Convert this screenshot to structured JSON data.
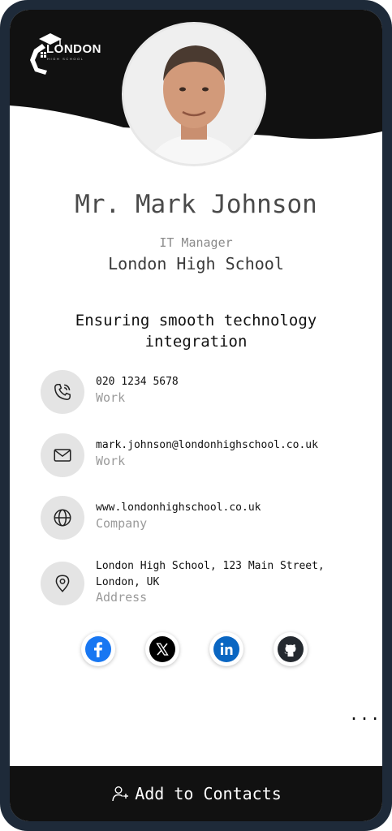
{
  "brand": {
    "name": "LONDON",
    "sub": "HIGH SCHOOL"
  },
  "profile": {
    "name": "Mr. Mark Johnson",
    "role": "IT Manager",
    "organization": "London High School",
    "tagline": "Ensuring smooth technology integration"
  },
  "contacts": [
    {
      "icon": "phone-icon",
      "value": "020 1234 5678",
      "label": "Work"
    },
    {
      "icon": "mail-icon",
      "value": "mark.johnson@londonhighschool.co.uk",
      "label": "Work"
    },
    {
      "icon": "globe-icon",
      "value": "www.londonhighschool.co.uk",
      "label": "Company"
    },
    {
      "icon": "location-pin-icon",
      "value": "London High School, 123 Main Street, London, UK",
      "label": "Address"
    }
  ],
  "socials": [
    "facebook-icon",
    "x-icon",
    "linkedin-icon",
    "github-icon"
  ],
  "more": "...",
  "cta": {
    "label": "Add to Contacts",
    "icon": "add-user-icon"
  },
  "colors": {
    "frame": "#1e2a39",
    "header": "#111111",
    "icon_bg": "#e4e4e4",
    "facebook": "#1877f2",
    "linkedin": "#0a66c2"
  }
}
